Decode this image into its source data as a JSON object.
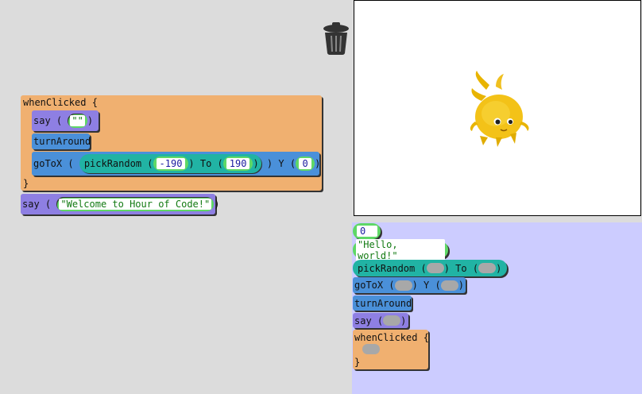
{
  "workspace": {
    "script": {
      "when_clicked": "whenClicked {",
      "close_brace": "}",
      "say": {
        "keyword": "say",
        "value": "\"\""
      },
      "turn_around": "turnAround",
      "goto": {
        "keyword": "goToX",
        "pick_keyword": "pickRandom",
        "to_keyword": "To",
        "from_value": "-190",
        "to_value": "190",
        "y_keyword": "Y",
        "y_value": "0"
      }
    },
    "loose_say": {
      "keyword": "say",
      "value": "\"Welcome to Hour of Code!\""
    }
  },
  "palette": {
    "number": "0",
    "string": "\"Hello, world!\"",
    "pick_random": {
      "keyword": "pickRandom",
      "to_keyword": "To"
    },
    "goto": {
      "keyword": "goToX",
      "y_keyword": "Y"
    },
    "turn_around": "turnAround",
    "say": "say",
    "when_clicked": "whenClicked {",
    "close_brace": "}"
  },
  "icons": {
    "trash": "trash-can-icon",
    "character": "yellow-monster-sprite"
  },
  "colors": {
    "workspace_bg": "#dcdcdc",
    "palette_bg": "#ccccff",
    "event_block": "#f0b070",
    "say_block": "#8e7fe3",
    "motion_block": "#4a90d9",
    "random_block": "#21b3a4",
    "literal_block": "#5fd866"
  }
}
